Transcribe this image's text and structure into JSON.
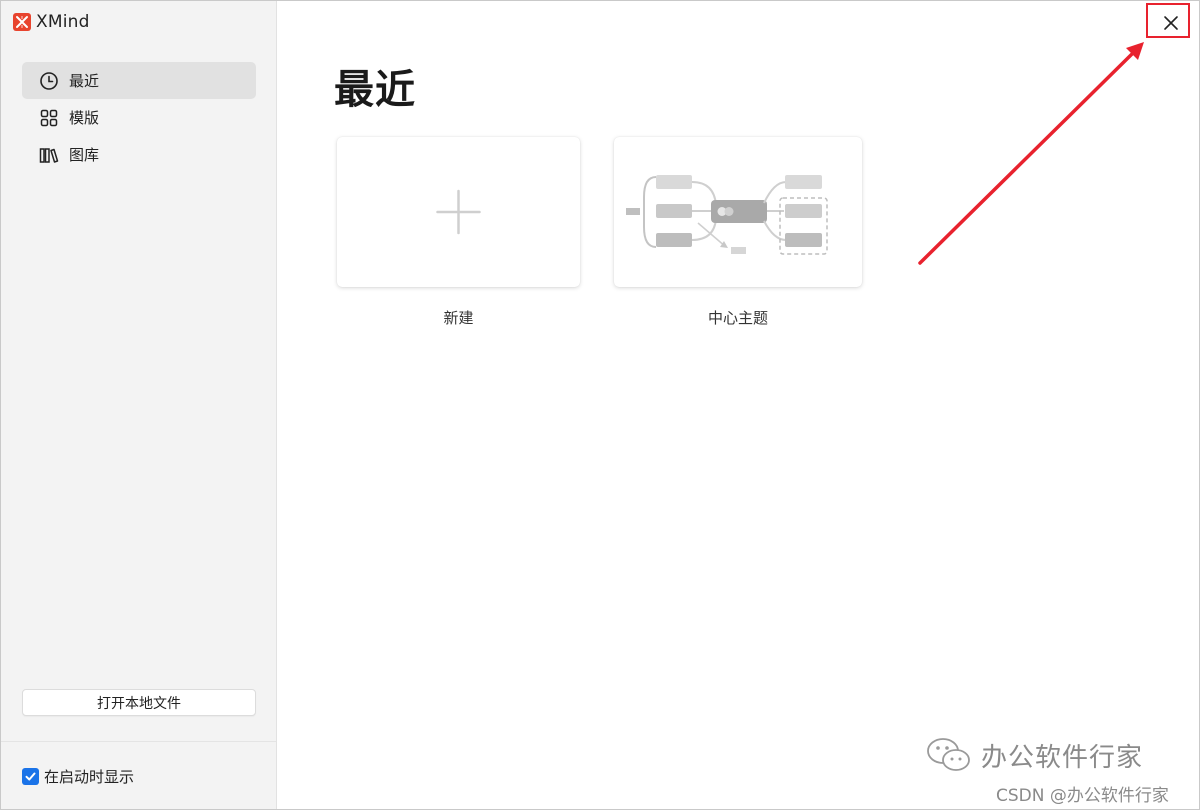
{
  "app": {
    "name": "XMind",
    "brand_color": "#e8442e"
  },
  "sidebar": {
    "items": [
      {
        "label": "最近",
        "icon": "clock-icon",
        "active": true
      },
      {
        "label": "模版",
        "icon": "template-grid-icon",
        "active": false
      },
      {
        "label": "图库",
        "icon": "library-books-icon",
        "active": false
      }
    ],
    "open_local_label": "打开本地文件",
    "show_on_startup_label": "在启动时显示",
    "show_on_startup_checked": true
  },
  "main": {
    "title": "最近",
    "cards": [
      {
        "label": "新建",
        "icon": "plus-icon"
      },
      {
        "label": "中心主题",
        "icon": "mindmap-thumbnail"
      }
    ]
  },
  "window": {
    "close_icon": "close-icon"
  },
  "annotation": {
    "color": "#e8222e"
  },
  "watermark": {
    "text": "办公软件行家",
    "sub": "CSDN @办公软件行家"
  }
}
